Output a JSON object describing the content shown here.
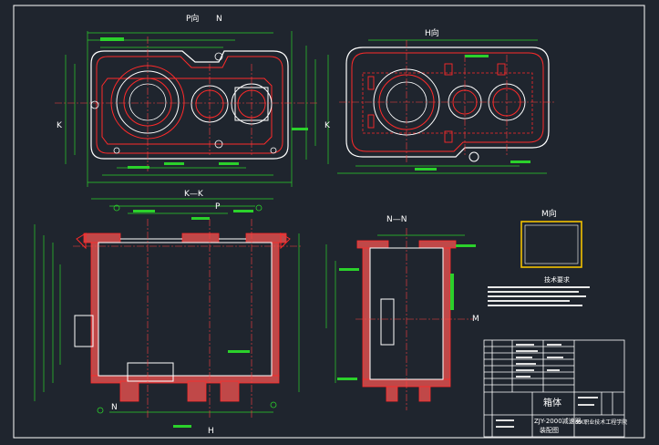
{
  "drawing": {
    "view_titles": {
      "p_view": "P向",
      "n_mark": "N",
      "h_view": "H向",
      "k_section": "K—K",
      "k_left": "K",
      "k_right": "K",
      "n_section": "N—N",
      "m_view": "M向",
      "m_arrow": "M",
      "h_arrow": "H",
      "p_arrow": "P",
      "n_arrow": "N"
    },
    "notes_title": "技术要求",
    "title_block": {
      "part_name": "箱体",
      "drawing_no": "ZJY-2000减速器",
      "sheet_label": "装配图",
      "school": "XX职业技术工程学院"
    }
  },
  "colors": {
    "background": "#1f252e",
    "outline": "#ffffff",
    "section": "#ff2a2a",
    "dimension": "#2bd12b",
    "hatch": "#e05050",
    "center": "#ff4040",
    "yellow": "#f2c200",
    "cyan": "#30c8ff"
  }
}
